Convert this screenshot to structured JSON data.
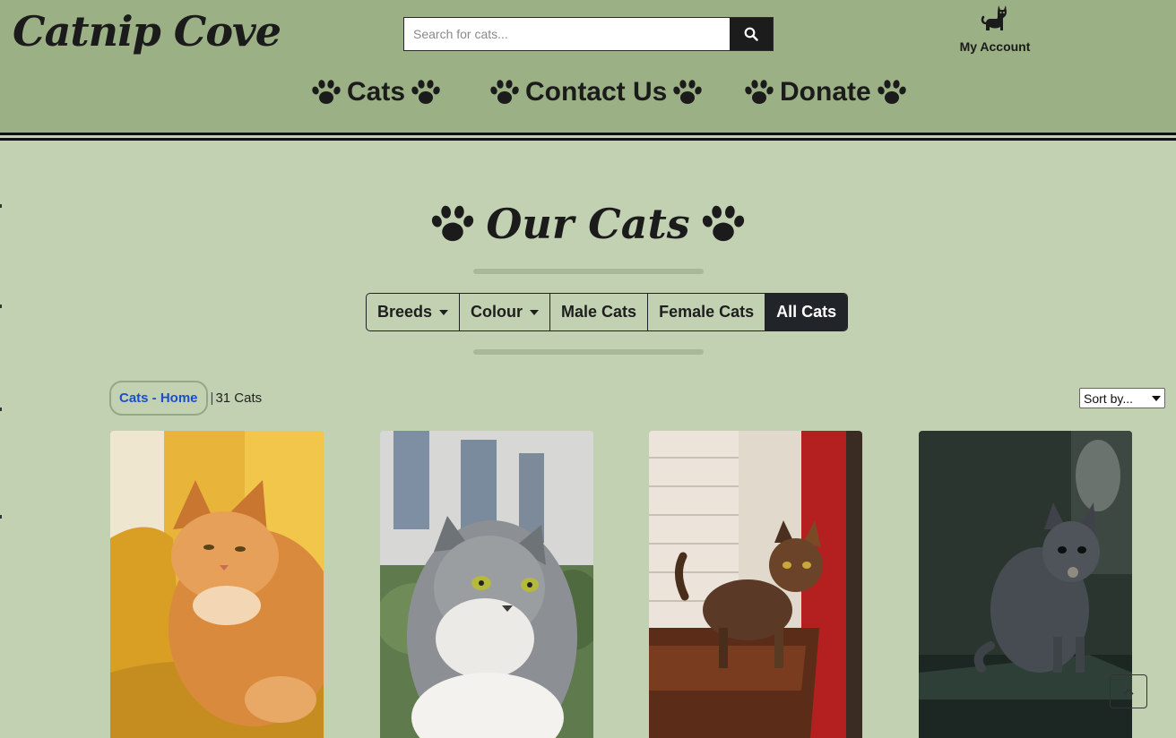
{
  "brand": {
    "name": "Catnip Cove"
  },
  "search": {
    "placeholder": "Search for cats..."
  },
  "account": {
    "label": "My Account"
  },
  "nav": {
    "items": [
      "Cats",
      "Contact Us",
      "Donate"
    ]
  },
  "main": {
    "title": "Our Cats",
    "filters": [
      {
        "label": "Breeds",
        "dropdown": true,
        "active": false
      },
      {
        "label": "Colour",
        "dropdown": true,
        "active": false
      },
      {
        "label": "Male Cats",
        "dropdown": false,
        "active": false
      },
      {
        "label": "Female Cats",
        "dropdown": false,
        "active": false
      },
      {
        "label": "All Cats",
        "dropdown": false,
        "active": true
      }
    ],
    "breadcrumb": "Cats - Home",
    "count_sep": "|",
    "count_text": "31 Cats",
    "sort": {
      "selected": "Sort by..."
    }
  },
  "cards": [
    {
      "alt": "ginger maine coon cat"
    },
    {
      "alt": "grey and white long-haired cat"
    },
    {
      "alt": "tortoiseshell cat"
    },
    {
      "alt": "grey cat"
    }
  ],
  "colors": {
    "header_bg": "#9bb084",
    "page_bg": "#c2d1b2",
    "active_filter_bg": "#212529",
    "link_blue": "#1a4fc8"
  },
  "icons": [
    "paw-icon",
    "search-icon",
    "cat-icon",
    "caret-down-icon",
    "chevron-up-icon"
  ]
}
